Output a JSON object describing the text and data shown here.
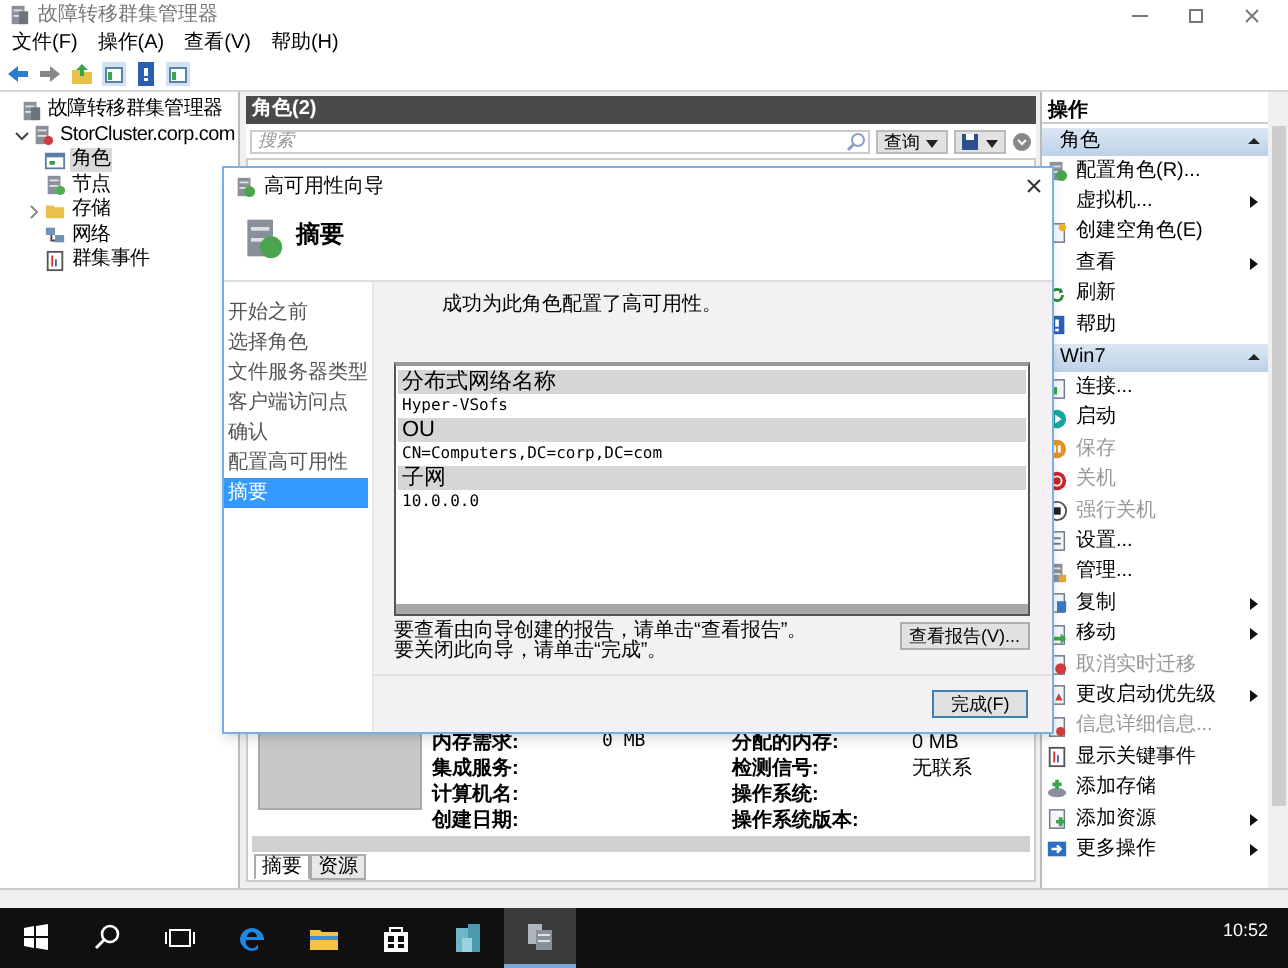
{
  "window": {
    "title": "故障转移群集管理器"
  },
  "menu": [
    "文件(F)",
    "操作(A)",
    "查看(V)",
    "帮助(H)"
  ],
  "tree": [
    {
      "label": "故障转移群集管理器",
      "kind": "app",
      "selected": false,
      "children": [
        {
          "label": "StorCluster.corp.com",
          "kind": "cluster",
          "selected": false,
          "expanded": true,
          "children": [
            {
              "label": "角色",
              "kind": "roles",
              "selected": true
            },
            {
              "label": "节点",
              "kind": "nodes",
              "selected": false
            },
            {
              "label": "存储",
              "kind": "storage",
              "selected": false,
              "expanded": false
            },
            {
              "label": "网络",
              "kind": "network",
              "selected": false
            },
            {
              "label": "群集事件",
              "kind": "events",
              "selected": false
            }
          ]
        }
      ]
    }
  ],
  "roles_panel": {
    "title": "角色(2)",
    "search": {
      "placeholder": "搜索"
    },
    "query_button": "查询",
    "details": [
      {
        "label": "内存需求:",
        "value": "0 MB",
        "label_2": "分配的内存:",
        "value_2": "0 MB"
      },
      {
        "label": "集成服务:",
        "label_2": "检测信号:",
        "value_2": "无联系"
      },
      {
        "label": "计算机名:",
        "label_2": "操作系统:"
      },
      {
        "label": "创建日期:",
        "label_2": "操作系统版本:"
      }
    ],
    "tabs": [
      {
        "label": "摘要",
        "selected": true
      },
      {
        "label": "资源",
        "selected": false
      }
    ]
  },
  "dialog": {
    "title": "高可用性向导",
    "heading": "摘要",
    "steps": [
      {
        "label": "开始之前",
        "selected": false
      },
      {
        "label": "选择角色",
        "selected": false
      },
      {
        "label": "文件服务器类型",
        "selected": false
      },
      {
        "label": "客户端访问点",
        "selected": false
      },
      {
        "label": "确认",
        "selected": false
      },
      {
        "label": "配置高可用性",
        "selected": false
      },
      {
        "label": "摘要",
        "selected": true
      }
    ],
    "message": "成功为此角色配置了高可用性。",
    "report": [
      {
        "heading": "分布式网络名称",
        "value": "Hyper-VSofs"
      },
      {
        "heading": "OU",
        "value": "CN=Computers,DC=corp,DC=com"
      },
      {
        "heading": "子网",
        "value": "10.0.0.0"
      }
    ],
    "notes": [
      "要查看由向导创建的报告，请单击“查看报告”。",
      "要关闭此向导，请单击“完成”。"
    ],
    "view_report_button": "查看报告(V)...",
    "finish_button": "完成(F)"
  },
  "actions": {
    "title": "操作",
    "sections": [
      {
        "title": "角色",
        "items": [
          {
            "label": "配置角色(R)...",
            "kind": "wizard",
            "disabled": false,
            "submenu": false
          },
          {
            "label": "虚拟机...",
            "disabled": false,
            "submenu": true
          },
          {
            "label": "创建空角色(E)",
            "kind": "newdoc",
            "disabled": false,
            "submenu": false
          },
          {
            "label": "查看",
            "disabled": false,
            "submenu": true
          },
          {
            "label": "刷新",
            "kind": "refresh",
            "disabled": false,
            "submenu": false
          },
          {
            "label": "帮助",
            "kind": "help",
            "disabled": false,
            "submenu": false
          }
        ]
      },
      {
        "title": "Win7",
        "items": [
          {
            "label": "连接...",
            "kind": "connect",
            "disabled": false,
            "submenu": false
          },
          {
            "label": "启动",
            "kind": "start",
            "disabled": false,
            "submenu": false
          },
          {
            "label": "保存",
            "kind": "save",
            "disabled": true,
            "submenu": false
          },
          {
            "label": "关机",
            "kind": "power",
            "disabled": true,
            "submenu": false
          },
          {
            "label": "强行关机",
            "kind": "stop",
            "disabled": true,
            "submenu": false
          },
          {
            "label": "设置...",
            "kind": "settings",
            "disabled": false,
            "submenu": false
          },
          {
            "label": "管理...",
            "kind": "manage",
            "disabled": false,
            "submenu": false
          },
          {
            "label": "复制",
            "kind": "copy",
            "disabled": false,
            "submenu": true
          },
          {
            "label": "移动",
            "kind": "move",
            "disabled": false,
            "submenu": true
          },
          {
            "label": "取消实时迁移",
            "kind": "cancel",
            "disabled": true,
            "submenu": false
          },
          {
            "label": "更改启动优先级",
            "kind": "priority",
            "disabled": false,
            "submenu": true
          },
          {
            "label": "信息详细信息...",
            "kind": "info",
            "disabled": true,
            "submenu": false
          },
          {
            "label": "显示关键事件",
            "kind": "events",
            "disabled": false,
            "submenu": false
          },
          {
            "label": "添加存储",
            "kind": "disk",
            "disabled": false,
            "submenu": false
          },
          {
            "label": "添加资源",
            "kind": "resource",
            "disabled": false,
            "submenu": true
          },
          {
            "label": "更多操作",
            "kind": "more",
            "disabled": false,
            "submenu": true
          }
        ]
      }
    ]
  },
  "taskbar": {
    "items": [
      {
        "kind": "start",
        "active": false
      },
      {
        "kind": "search",
        "active": false
      },
      {
        "kind": "taskview",
        "active": false
      },
      {
        "kind": "edge",
        "active": false
      },
      {
        "kind": "explorer",
        "active": false
      },
      {
        "kind": "store",
        "active": false
      },
      {
        "kind": "servers",
        "active": false
      },
      {
        "kind": "cluster",
        "active": true
      }
    ],
    "time": "10:52"
  }
}
